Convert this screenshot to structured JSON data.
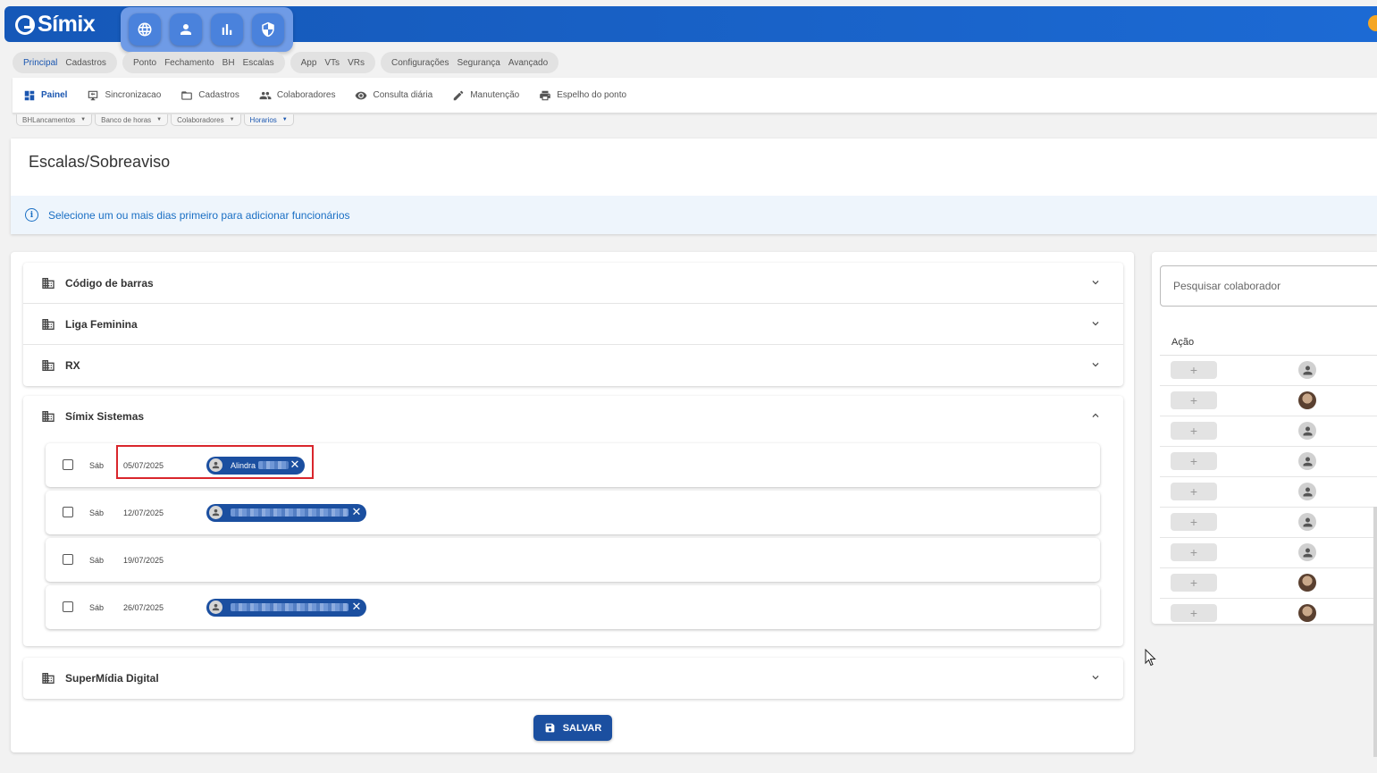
{
  "brand": {
    "name": "Símix"
  },
  "top_icons": [
    "globe-icon",
    "user-icon",
    "bar-chart-icon",
    "shield-icon"
  ],
  "pill_groups": [
    {
      "items": [
        "Principal",
        "Cadastros"
      ],
      "active": 0
    },
    {
      "items": [
        "Ponto",
        "Fechamento",
        "BH",
        "Escalas"
      ],
      "active": -1
    },
    {
      "items": [
        "App",
        "VTs",
        "VRs"
      ],
      "active": -1
    },
    {
      "items": [
        "Configurações",
        "Segurança",
        "Avançado"
      ],
      "active": -1
    }
  ],
  "nav": {
    "items": [
      {
        "label": "Painel",
        "icon": "dashboard-icon",
        "active": true
      },
      {
        "label": "Sincronizacao",
        "icon": "sync-icon",
        "active": false
      },
      {
        "label": "Cadastros",
        "icon": "folder-icon",
        "active": false
      },
      {
        "label": "Colaboradores",
        "icon": "people-icon",
        "active": false
      },
      {
        "label": "Consulta diária",
        "icon": "eye-icon",
        "active": false
      },
      {
        "label": "Manutenção",
        "icon": "pencil-icon",
        "active": false
      },
      {
        "label": "Espelho do ponto",
        "icon": "printer-icon",
        "active": false
      }
    ]
  },
  "subtabs": [
    {
      "label": "BHLancamentos",
      "active": false
    },
    {
      "label": "Banco de horas",
      "active": false
    },
    {
      "label": "Colaboradores",
      "active": false
    },
    {
      "label": "Horarios",
      "active": true
    }
  ],
  "page": {
    "title": "Escalas/Sobreaviso",
    "info": "Selecione um ou mais dias primeiro para adicionar funcionários"
  },
  "companies_top": [
    "Código de barras",
    "Liga Feminina",
    "RX"
  ],
  "company_open": {
    "name": "Símix Sistemas",
    "days": [
      {
        "dow": "Sáb",
        "date": "05/07/2025",
        "chip": "Alindra",
        "blur": true
      },
      {
        "dow": "Sáb",
        "date": "12/07/2025",
        "chip": "",
        "blur": true
      },
      {
        "dow": "Sáb",
        "date": "19/07/2025",
        "chip": null,
        "blur": false
      },
      {
        "dow": "Sáb",
        "date": "26/07/2025",
        "chip": "",
        "blur": true
      }
    ]
  },
  "companies_bottom": [
    "SuperMídia Digital"
  ],
  "save_label": "SALVAR",
  "right_panel": {
    "search_placeholder": "Pesquisar colaborador",
    "col_action": "Ação",
    "rows": [
      {
        "avatar": "default"
      },
      {
        "avatar": "photo"
      },
      {
        "avatar": "default"
      },
      {
        "avatar": "default"
      },
      {
        "avatar": "default"
      },
      {
        "avatar": "default"
      },
      {
        "avatar": "default"
      },
      {
        "avatar": "photo"
      },
      {
        "avatar": "photo"
      }
    ]
  }
}
